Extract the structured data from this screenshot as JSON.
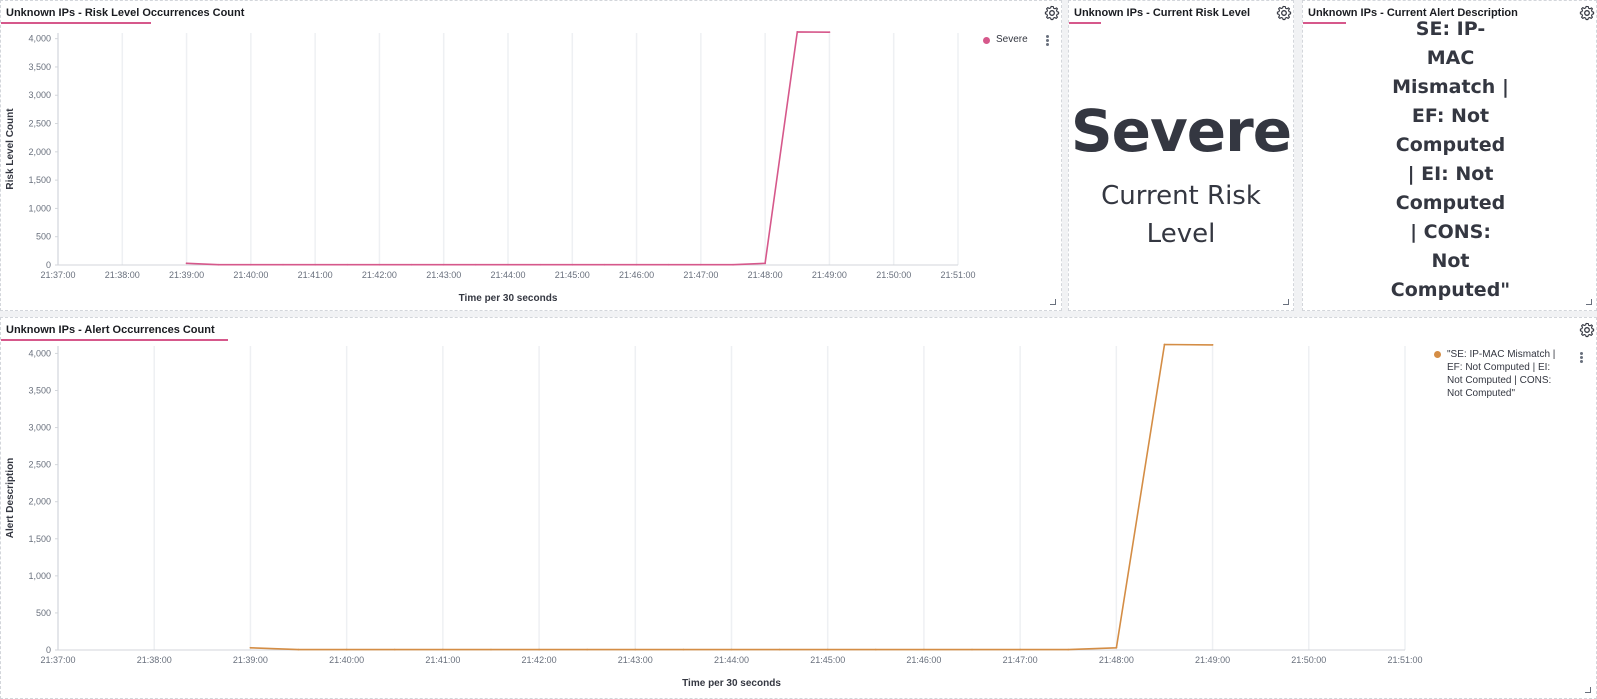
{
  "panels": {
    "risk_count": {
      "title": "Unknown IPs - Risk Level Occurrences Count",
      "legend": "Severe",
      "ylabel": "Risk Level Count",
      "xlabel": "Time per 30 seconds"
    },
    "current_risk": {
      "title": "Unknown IPs - Current Risk Level",
      "value": "Severe",
      "label_line1": "Current Risk",
      "label_line2": "Level"
    },
    "current_alert": {
      "title": "Unknown IPs - Current Alert Description",
      "lines": [
        "SE: IP-",
        "MAC",
        "Mismatch |",
        "EF: Not",
        "Computed",
        "| EI: Not",
        "Computed",
        "| CONS:",
        "Not",
        "Computed\""
      ]
    },
    "alert_count": {
      "title": "Unknown IPs - Alert Occurrences Count",
      "legend_lines": [
        "\"SE: IP-MAC Mismatch |",
        "EF: Not Computed | EI:",
        "Not Computed | CONS:",
        "Not Computed\""
      ],
      "ylabel": "Alert Description",
      "xlabel": "Time per 30 seconds"
    }
  },
  "colors": {
    "pink": "#d6588b",
    "orange": "#d48d45",
    "text": "#343741"
  },
  "icons": [
    "gear-icon",
    "resize-handle-icon",
    "legend-options-icon"
  ],
  "chart_data": [
    {
      "type": "line",
      "title": "Unknown IPs - Risk Level Occurrences Count",
      "xlabel": "Time per 30 seconds",
      "ylabel": "Risk Level Count",
      "x_ticks": [
        "21:37:00",
        "21:38:00",
        "21:39:00",
        "21:40:00",
        "21:41:00",
        "21:42:00",
        "21:43:00",
        "21:44:00",
        "21:45:00",
        "21:46:00",
        "21:47:00",
        "21:48:00",
        "21:49:00",
        "21:50:00",
        "21:51:00"
      ],
      "y_ticks": [
        "0",
        "500",
        "1,000",
        "1,500",
        "2,000",
        "2,500",
        "3,000",
        "3,500",
        "4,000"
      ],
      "ylim": [
        0,
        4100
      ],
      "series": [
        {
          "name": "Severe",
          "x": [
            "21:39:00",
            "21:39:30",
            "21:40:00",
            "21:40:30",
            "21:41:00",
            "21:41:30",
            "21:42:00",
            "21:42:30",
            "21:43:00",
            "21:43:30",
            "21:44:00",
            "21:44:30",
            "21:45:00",
            "21:45:30",
            "21:46:00",
            "21:46:30",
            "21:47:00",
            "21:47:30",
            "21:48:00",
            "21:48:30",
            "21:49:00"
          ],
          "values": [
            30,
            5,
            5,
            5,
            5,
            5,
            5,
            5,
            5,
            5,
            5,
            5,
            5,
            5,
            5,
            5,
            5,
            5,
            30,
            4120,
            4115
          ]
        }
      ]
    },
    {
      "type": "line",
      "title": "Unknown IPs - Alert Occurrences Count",
      "xlabel": "Time per 30 seconds",
      "ylabel": "Alert Description",
      "x_ticks": [
        "21:37:00",
        "21:38:00",
        "21:39:00",
        "21:40:00",
        "21:41:00",
        "21:42:00",
        "21:43:00",
        "21:44:00",
        "21:45:00",
        "21:46:00",
        "21:47:00",
        "21:48:00",
        "21:49:00",
        "21:50:00",
        "21:51:00"
      ],
      "y_ticks": [
        "0",
        "500",
        "1,000",
        "1,500",
        "2,000",
        "2,500",
        "3,000",
        "3,500",
        "4,000"
      ],
      "ylim": [
        0,
        4100
      ],
      "series": [
        {
          "name": "\"SE: IP-MAC Mismatch | EF: Not Computed | EI: Not Computed | CONS: Not Computed\"",
          "x": [
            "21:39:00",
            "21:39:30",
            "21:40:00",
            "21:40:30",
            "21:41:00",
            "21:41:30",
            "21:42:00",
            "21:42:30",
            "21:43:00",
            "21:43:30",
            "21:44:00",
            "21:44:30",
            "21:45:00",
            "21:45:30",
            "21:46:00",
            "21:46:30",
            "21:47:00",
            "21:47:30",
            "21:48:00",
            "21:48:30",
            "21:49:00"
          ],
          "values": [
            30,
            5,
            5,
            5,
            5,
            5,
            5,
            5,
            5,
            5,
            5,
            5,
            5,
            5,
            5,
            5,
            5,
            5,
            30,
            4120,
            4115
          ]
        }
      ]
    }
  ]
}
